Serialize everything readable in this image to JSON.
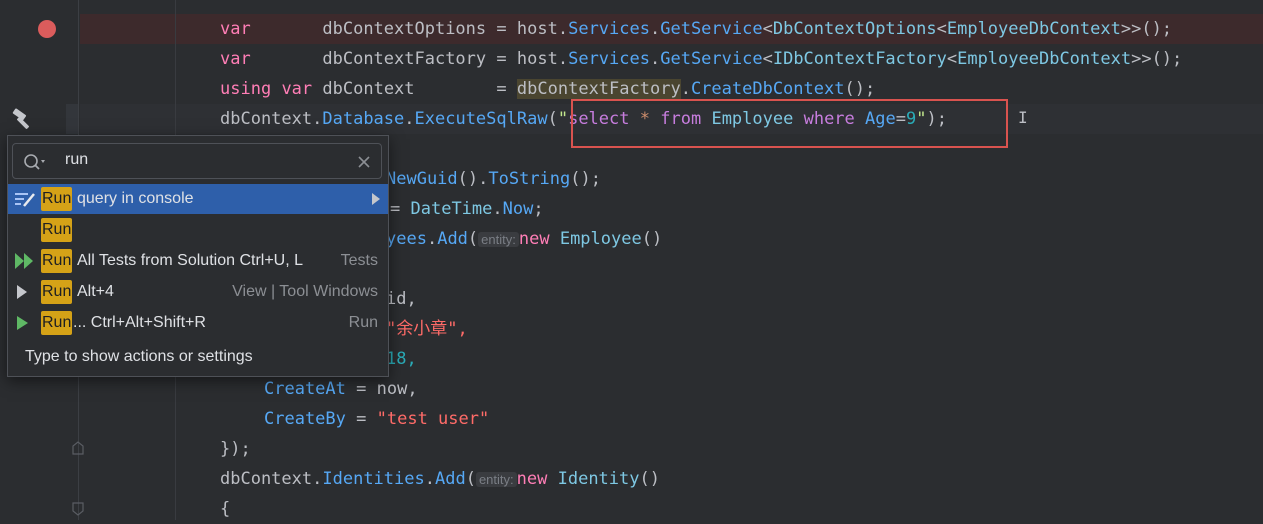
{
  "code": {
    "line1": {
      "kw": "var",
      "name": "dbContextOptions",
      "eq": "=",
      "host": "host",
      "dot1": ".",
      "services": "Services",
      "dot2": ".",
      "getservice": "GetService",
      "lt": "<",
      "t1": "DbContextOptions",
      "lt2": "<",
      "t2": "EmployeeDbContext",
      "end": ">>();"
    },
    "line2": {
      "kw": "var",
      "name": "dbContextFactory",
      "eq": "=",
      "host": "host",
      "dot1": ".",
      "services": "Services",
      "dot2": ".",
      "getservice": "GetService",
      "lt": "<",
      "t1": "IDbContextFactory",
      "lt2": "<",
      "t2": "EmployeeDbContext",
      "end": ">>();"
    },
    "line3": {
      "kw1": "using",
      "kw2": "var",
      "name": "dbContext",
      "eq": "=",
      "factory": "dbContextFactory",
      "dot": ".",
      "create": "CreateDbContext",
      "end": "();"
    },
    "line4": {
      "obj": "dbContext",
      "dot1": ".",
      "database": "Database",
      "dot2": ".",
      "exec": "ExecuteSqlRaw",
      "open": "(",
      "q1": "\"",
      "select": "select",
      "star": "*",
      "from": "from",
      "table": "Employee",
      "where": "where",
      "col": "Age",
      "eq": "=",
      "val": "9",
      "q2": "\"",
      "end": ");"
    },
    "line6": {
      "text": "NewGuid",
      "rest": "().",
      "tostring": "ToString",
      "end": "();"
    },
    "line7": {
      "eq": "=",
      "type": "DateTime",
      "dot": ".",
      "now": "Now",
      "end": ";"
    },
    "line8": {
      "pre": "yees",
      "dot": ".",
      "add": "Add",
      "open": "(",
      "hint": "entity:",
      "kw": "new",
      "type": "Employee",
      "end": "()"
    },
    "line10": {
      "text": "id,"
    },
    "line11": {
      "text": "\"余小章\","
    },
    "line12": {
      "text": "18,"
    },
    "line13": {
      "prop": "CreateAt",
      "eq": "=",
      "val": "now,"
    },
    "line14": {
      "prop": "CreateBy",
      "eq": "=",
      "val": "\"test user\""
    },
    "line15": {
      "text": "});"
    },
    "line16": {
      "obj": "dbContext",
      "dot1": ".",
      "prop": "Identities",
      "dot2": ".",
      "add": "Add",
      "open": "(",
      "hint": "entity:",
      "kw": "new",
      "type": "Identity",
      "end": "()"
    },
    "line17": {
      "text": "{"
    }
  },
  "popup": {
    "search_value": "run",
    "items": [
      {
        "run": "Run",
        "rest": "query in console",
        "right": ""
      },
      {
        "run": "Run",
        "rest": "",
        "right": ""
      },
      {
        "run": "Run",
        "rest": "All Tests from Solution Ctrl+U, L",
        "right": "Tests"
      },
      {
        "run": "Run",
        "rest": "Alt+4",
        "right": "View | Tool Windows"
      },
      {
        "run": "Run",
        "rest": "... Ctrl+Alt+Shift+R",
        "right": "Run"
      }
    ],
    "hint": "Type to show actions or settings"
  }
}
